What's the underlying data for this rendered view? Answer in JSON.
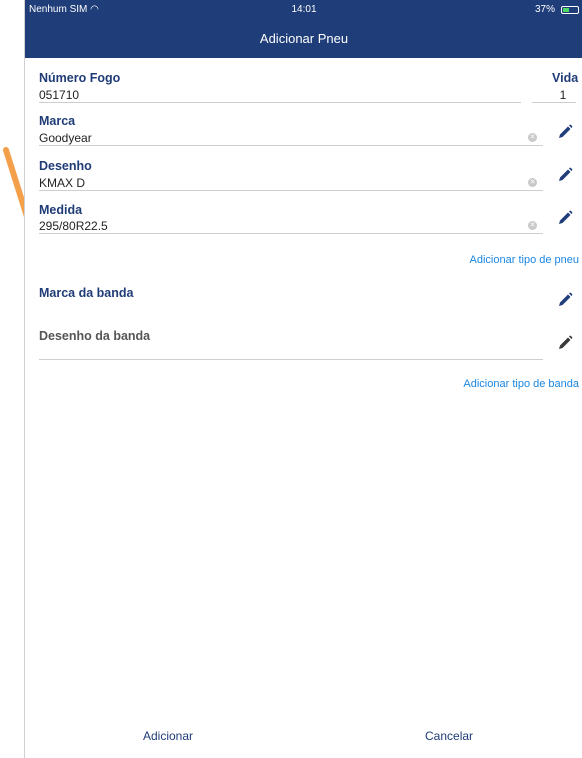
{
  "status_bar": {
    "carrier": "Nenhum SIM ◠",
    "time": "14:01",
    "battery": "37%"
  },
  "nav_bar": {
    "title": "Adicionar Pneu"
  },
  "form": {
    "numero_fogo": {
      "label": "Número Fogo",
      "value": "051710"
    },
    "vida": {
      "label": "Vida",
      "value": "1"
    },
    "marca": {
      "label": "Marca",
      "value": "Goodyear"
    },
    "desenho": {
      "label": "Desenho",
      "value": "KMAX D"
    },
    "medida": {
      "label": "Medida",
      "value": "295/80R22.5"
    },
    "adicionar_tipo_pneu": "Adicionar tipo de pneu",
    "marca_banda": {
      "label": "Marca da banda"
    },
    "desenho_banda": {
      "label": "Desenho da banda"
    },
    "adicionar_tipo_banda": "Adicionar tipo de banda"
  },
  "footer": {
    "add_label": "Adicionar",
    "cancel_label": "Cancelar"
  },
  "colors": {
    "brand": "#1f3d78",
    "link": "#1a86e0",
    "annotation_arrow": "#f4a04a"
  },
  "icons": [
    "wifi-icon",
    "battery-icon",
    "clear-icon",
    "pencil-icon",
    "annotation-arrow"
  ]
}
